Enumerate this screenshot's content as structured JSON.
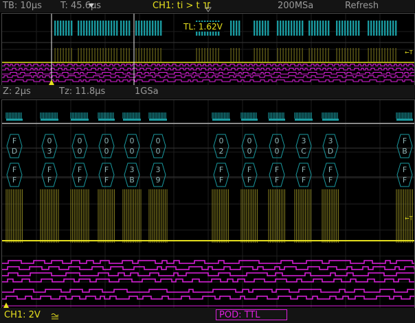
{
  "top_bar": {
    "timebase": "TB: 10µs",
    "trigger_time": "T: 45.6µs",
    "trigger": "CH1: ti > t",
    "sample_rate": "200MSa",
    "mode": "Refresh"
  },
  "overview": {
    "trigger_level": "TL: 1.62V",
    "trigger_marker": "T"
  },
  "zoom_bar": {
    "zoom": "Z: 2µs",
    "zoom_time": "Tz: 11.8µs",
    "zoom_rate": "1GSa"
  },
  "bus_decode": {
    "row1": [
      "FD",
      "03",
      "00",
      "00",
      "00",
      "00",
      "02",
      "00",
      "00",
      "3C",
      "3D",
      "FB"
    ],
    "row2": [
      "FF",
      "FF",
      "FF",
      "FF",
      "3B",
      "39",
      "FF",
      "FF",
      "FF",
      "FF",
      "FF",
      "FF"
    ]
  },
  "zoom_panel": {
    "trigger_marker": "T"
  },
  "bottom_bar": {
    "channel": "CH1: 2V",
    "pod": "POD: TTL"
  },
  "colors": {
    "ch1": "#e6e01e",
    "bus": "#1a9aa0",
    "digital": "#e020e0",
    "text": "#9a9a9a"
  }
}
